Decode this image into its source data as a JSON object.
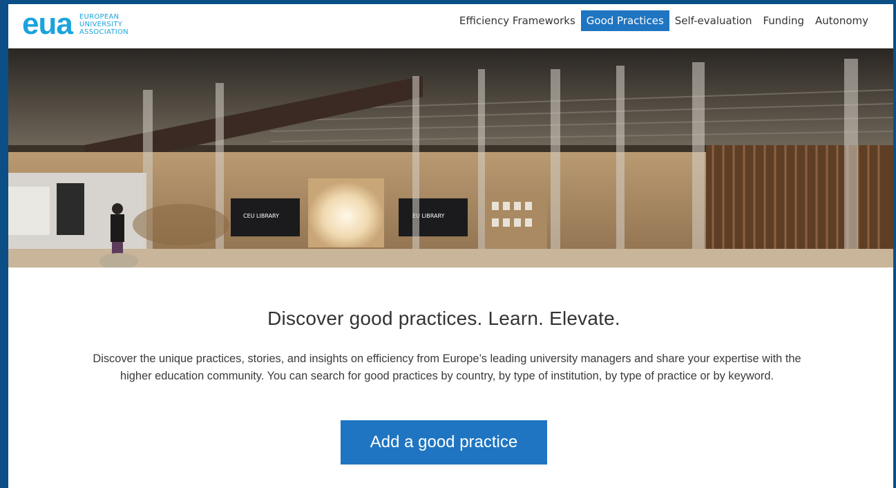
{
  "header": {
    "logo": {
      "mark": "eua",
      "lines": [
        "EUROPEAN",
        "UNIVERSITY",
        "ASSOCIATION"
      ]
    },
    "nav": [
      {
        "label": "Efficiency Frameworks",
        "active": false
      },
      {
        "label": "Good Practices",
        "active": true
      },
      {
        "label": "Self-evaluation",
        "active": false
      },
      {
        "label": "Funding",
        "active": false
      },
      {
        "label": "Autonomy",
        "active": false
      }
    ]
  },
  "hero": {
    "screen_texts": [
      "CEU LIBRARY",
      "EU LIBRARY"
    ]
  },
  "main": {
    "headline": "Discover good practices. Learn. Elevate.",
    "intro_line1": "Discover the unique practices, stories, and insights on efficiency from Europe’s leading university managers and share your expertise with the",
    "intro_line2": "higher education community. You can search for good practices by country, by type of institution, by type of practice or by keyword.",
    "cta_label": "Add a good practice"
  },
  "colors": {
    "brand_blue": "#1aa3dc",
    "nav_active": "#1f75c1",
    "frame_border": "#0b4f86"
  }
}
